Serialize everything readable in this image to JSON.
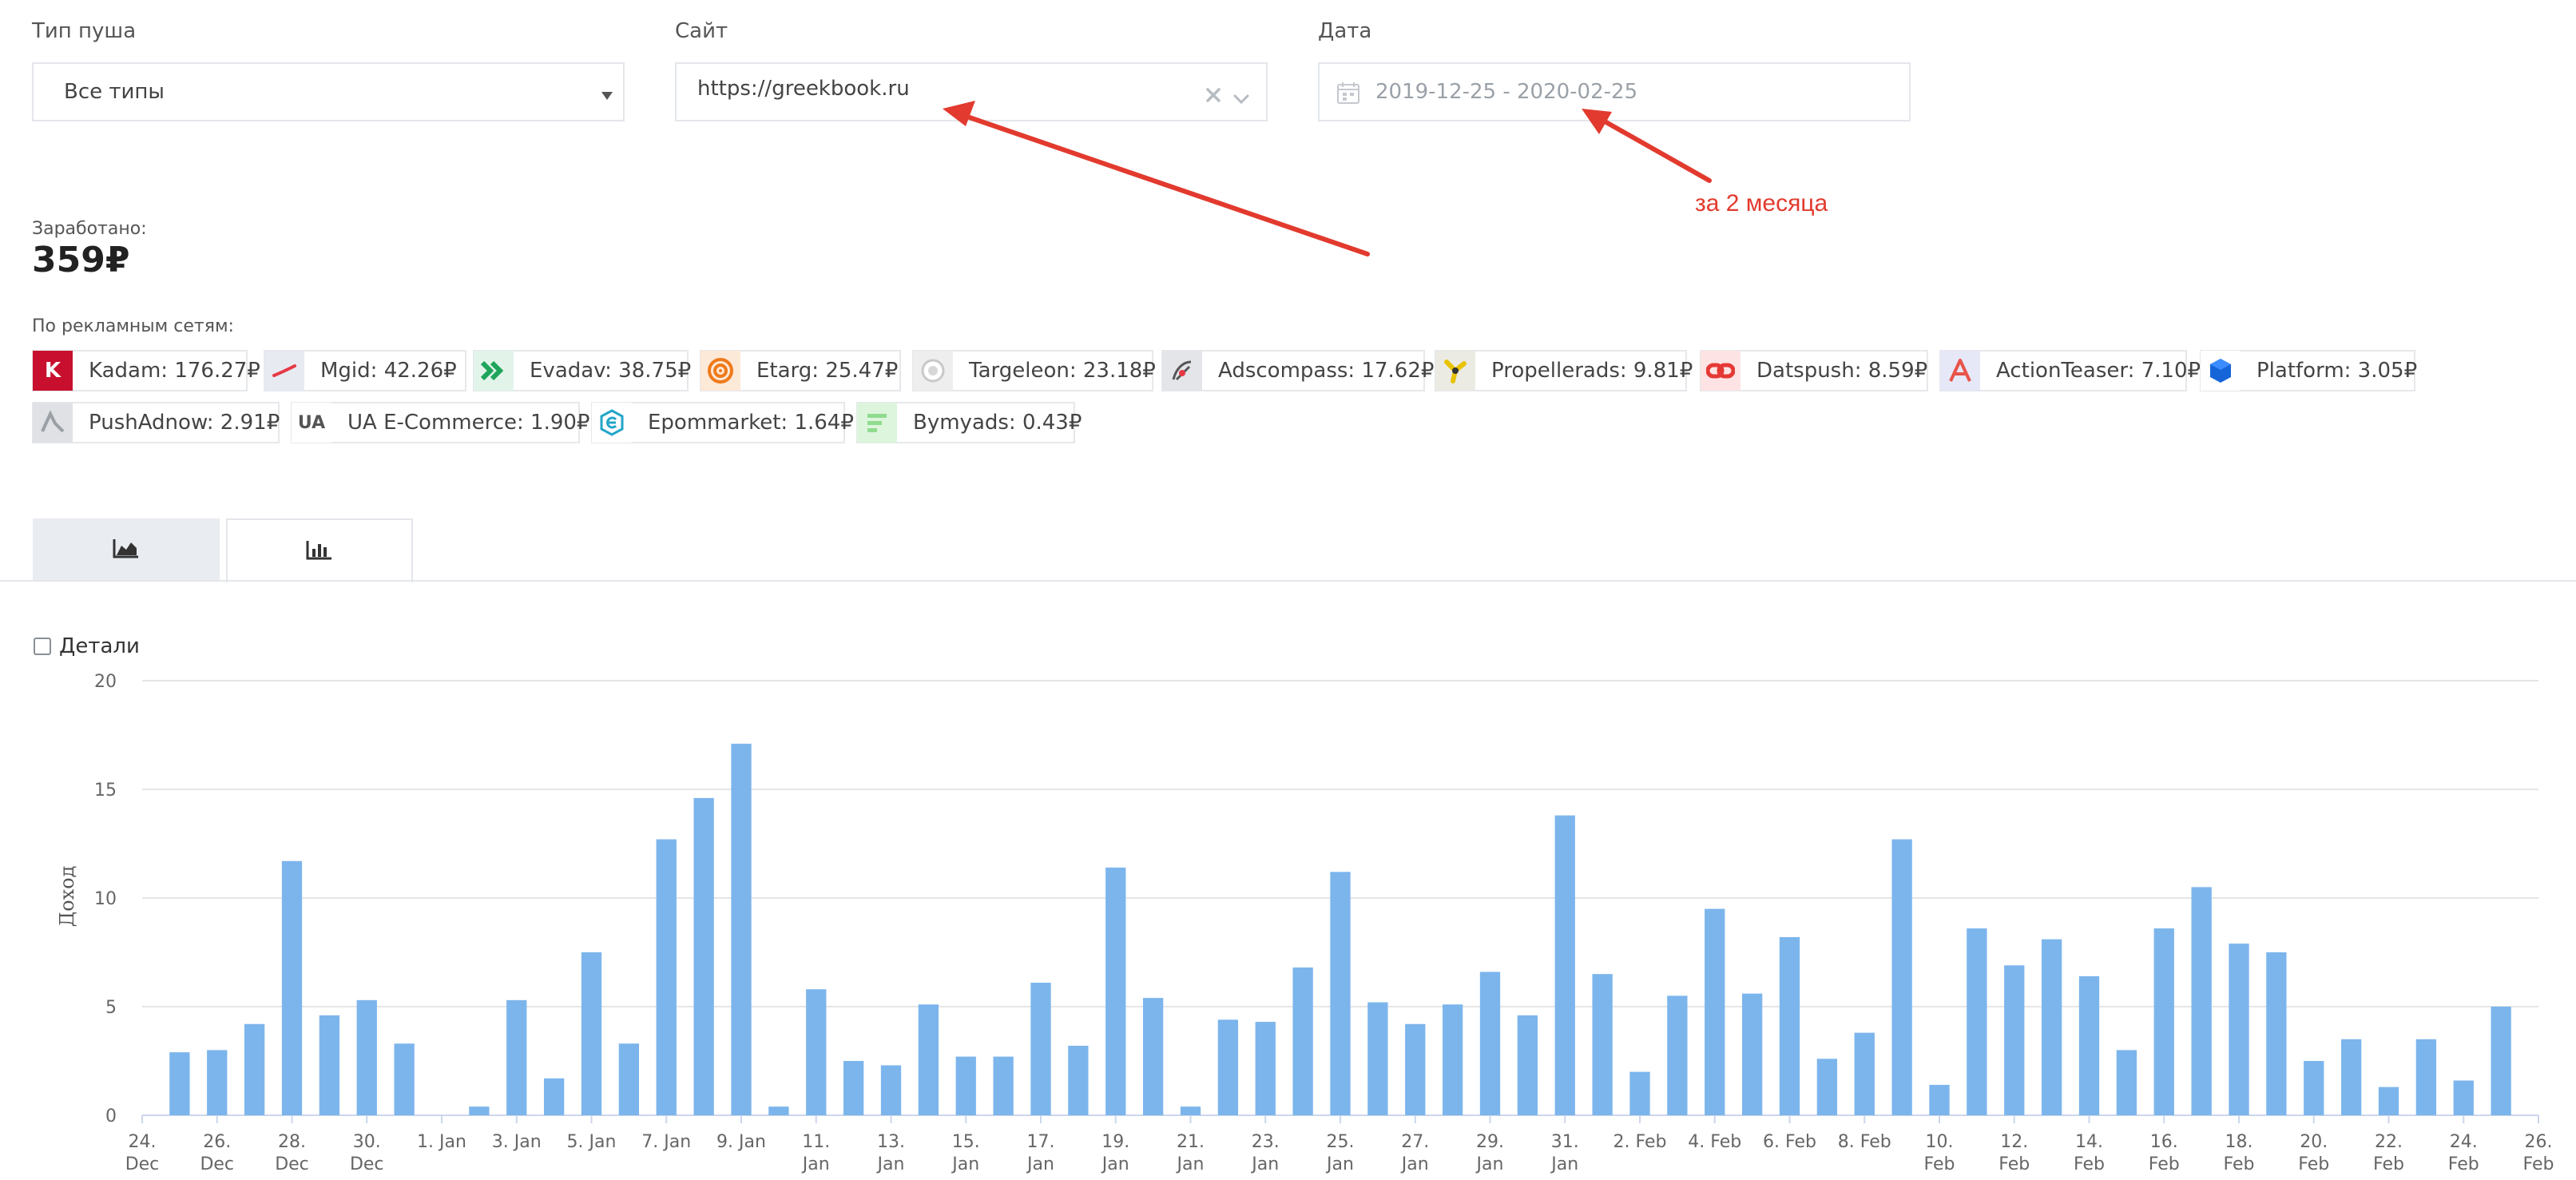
{
  "filters": {
    "push_type": {
      "label": "Тип пуша",
      "value": "Все типы"
    },
    "site": {
      "label": "Сайт",
      "value": "https://greekbook.ru"
    },
    "date": {
      "label": "Дата",
      "value": "2019-12-25 - 2020-02-25"
    }
  },
  "annotation": {
    "text": "за 2 месяца",
    "color": "#e23a2e"
  },
  "earned": {
    "label": "Заработано:",
    "value": "359₽"
  },
  "networks": {
    "label": "По рекламным сетям:",
    "items": [
      {
        "text": "Kadam: 176.27₽",
        "icon": "kadam-icon"
      },
      {
        "text": "Mgid: 42.26₽",
        "icon": "mgid-icon"
      },
      {
        "text": "Evadav: 38.75₽",
        "icon": "evadav-icon"
      },
      {
        "text": "Etarg: 25.47₽",
        "icon": "etarg-icon"
      },
      {
        "text": "Targeleon: 23.18₽",
        "icon": "targeleon-icon"
      },
      {
        "text": "Adscompass: 17.62₽",
        "icon": "adscompass-icon"
      },
      {
        "text": "Propellerads: 9.81₽",
        "icon": "propellerads-icon"
      },
      {
        "text": "Datspush: 8.59₽",
        "icon": "datspush-icon"
      },
      {
        "text": "ActionTeaser: 7.10₽",
        "icon": "actionteaser-icon"
      },
      {
        "text": "Platform: 3.05₽",
        "icon": "platform-icon"
      },
      {
        "text": "PushAdnow: 2.91₽",
        "icon": "pushadnow-icon"
      },
      {
        "text": "UA E-Commerce: 1.90₽",
        "icon": "ua-ecommerce-icon",
        "icon_text": "UA"
      },
      {
        "text": "Epommarket: 1.64₽",
        "icon": "epommarket-icon"
      },
      {
        "text": "Bymyads: 0.43₽",
        "icon": "bymyads-icon"
      }
    ]
  },
  "tabs": [
    {
      "icon": "area-chart-icon",
      "active": false
    },
    {
      "icon": "bar-chart-icon",
      "active": true
    }
  ],
  "details": {
    "label": "Детали",
    "checked": false
  },
  "chart_data": {
    "type": "bar",
    "ylabel": "Доход",
    "ylim": [
      0,
      20
    ],
    "yticks": [
      0,
      5,
      10,
      15,
      20
    ],
    "grid": true,
    "bar_color": "#7cb5ec",
    "x_tick_labels": [
      [
        "24.",
        "Dec"
      ],
      [
        "26.",
        "Dec"
      ],
      [
        "28.",
        "Dec"
      ],
      [
        "30.",
        "Dec"
      ],
      [
        "1. Jan",
        ""
      ],
      [
        "3. Jan",
        ""
      ],
      [
        "5. Jan",
        ""
      ],
      [
        "7. Jan",
        ""
      ],
      [
        "9. Jan",
        ""
      ],
      [
        "11.",
        "Jan"
      ],
      [
        "13.",
        "Jan"
      ],
      [
        "15.",
        "Jan"
      ],
      [
        "17.",
        "Jan"
      ],
      [
        "19.",
        "Jan"
      ],
      [
        "21.",
        "Jan"
      ],
      [
        "23.",
        "Jan"
      ],
      [
        "25.",
        "Jan"
      ],
      [
        "27.",
        "Jan"
      ],
      [
        "29.",
        "Jan"
      ],
      [
        "31.",
        "Jan"
      ],
      [
        "2. Feb",
        ""
      ],
      [
        "4. Feb",
        ""
      ],
      [
        "6. Feb",
        ""
      ],
      [
        "8. Feb",
        ""
      ],
      [
        "10.",
        "Feb"
      ],
      [
        "12.",
        "Feb"
      ],
      [
        "14.",
        "Feb"
      ],
      [
        "16.",
        "Feb"
      ],
      [
        "18.",
        "Feb"
      ],
      [
        "20.",
        "Feb"
      ],
      [
        "22.",
        "Feb"
      ],
      [
        "24.",
        "Feb"
      ],
      [
        "26.",
        "Feb"
      ]
    ],
    "x_start": "2019-12-24",
    "x_end": "2020-02-26",
    "points": [
      {
        "x": "2019-12-25",
        "y": 2.9
      },
      {
        "x": "2019-12-26",
        "y": 3.0
      },
      {
        "x": "2019-12-27",
        "y": 4.2
      },
      {
        "x": "2019-12-28",
        "y": 11.7
      },
      {
        "x": "2019-12-29",
        "y": 4.6
      },
      {
        "x": "2019-12-30",
        "y": 5.3
      },
      {
        "x": "2019-12-31",
        "y": 3.3
      },
      {
        "x": "2020-01-01",
        "y": 0
      },
      {
        "x": "2020-01-02",
        "y": 0.4
      },
      {
        "x": "2020-01-03",
        "y": 5.3
      },
      {
        "x": "2020-01-04",
        "y": 1.7
      },
      {
        "x": "2020-01-05",
        "y": 7.5
      },
      {
        "x": "2020-01-06",
        "y": 3.3
      },
      {
        "x": "2020-01-07",
        "y": 12.7
      },
      {
        "x": "2020-01-08",
        "y": 14.6
      },
      {
        "x": "2020-01-09",
        "y": 17.1
      },
      {
        "x": "2020-01-10",
        "y": 0.4
      },
      {
        "x": "2020-01-11",
        "y": 5.8
      },
      {
        "x": "2020-01-12",
        "y": 2.5
      },
      {
        "x": "2020-01-13",
        "y": 2.3
      },
      {
        "x": "2020-01-14",
        "y": 5.1
      },
      {
        "x": "2020-01-15",
        "y": 2.7
      },
      {
        "x": "2020-01-16",
        "y": 2.7
      },
      {
        "x": "2020-01-17",
        "y": 6.1
      },
      {
        "x": "2020-01-18",
        "y": 3.2
      },
      {
        "x": "2020-01-19",
        "y": 11.4
      },
      {
        "x": "2020-01-20",
        "y": 5.4
      },
      {
        "x": "2020-01-21",
        "y": 0.4
      },
      {
        "x": "2020-01-22",
        "y": 4.4
      },
      {
        "x": "2020-01-23",
        "y": 4.3
      },
      {
        "x": "2020-01-24",
        "y": 6.8
      },
      {
        "x": "2020-01-25",
        "y": 11.2
      },
      {
        "x": "2020-01-26",
        "y": 5.2
      },
      {
        "x": "2020-01-27",
        "y": 4.2
      },
      {
        "x": "2020-01-28",
        "y": 5.1
      },
      {
        "x": "2020-01-29",
        "y": 6.6
      },
      {
        "x": "2020-01-30",
        "y": 4.6
      },
      {
        "x": "2020-01-31",
        "y": 13.8
      },
      {
        "x": "2020-02-01",
        "y": 6.5
      },
      {
        "x": "2020-02-02",
        "y": 2.0
      },
      {
        "x": "2020-02-03",
        "y": 5.5
      },
      {
        "x": "2020-02-04",
        "y": 9.5
      },
      {
        "x": "2020-02-05",
        "y": 5.6
      },
      {
        "x": "2020-02-06",
        "y": 8.2
      },
      {
        "x": "2020-02-07",
        "y": 2.6
      },
      {
        "x": "2020-02-08",
        "y": 3.8
      },
      {
        "x": "2020-02-09",
        "y": 12.7
      },
      {
        "x": "2020-02-10",
        "y": 1.4
      },
      {
        "x": "2020-02-11",
        "y": 8.6
      },
      {
        "x": "2020-02-12",
        "y": 6.9
      },
      {
        "x": "2020-02-13",
        "y": 8.1
      },
      {
        "x": "2020-02-14",
        "y": 6.4
      },
      {
        "x": "2020-02-15",
        "y": 3.0
      },
      {
        "x": "2020-02-16",
        "y": 8.6
      },
      {
        "x": "2020-02-17",
        "y": 10.5
      },
      {
        "x": "2020-02-18",
        "y": 7.9
      },
      {
        "x": "2020-02-19",
        "y": 7.5
      },
      {
        "x": "2020-02-20",
        "y": 2.5
      },
      {
        "x": "2020-02-21",
        "y": 3.5
      },
      {
        "x": "2020-02-22",
        "y": 1.3
      },
      {
        "x": "2020-02-23",
        "y": 3.5
      },
      {
        "x": "2020-02-24",
        "y": 1.6
      },
      {
        "x": "2020-02-25",
        "y": 5.0
      }
    ]
  }
}
